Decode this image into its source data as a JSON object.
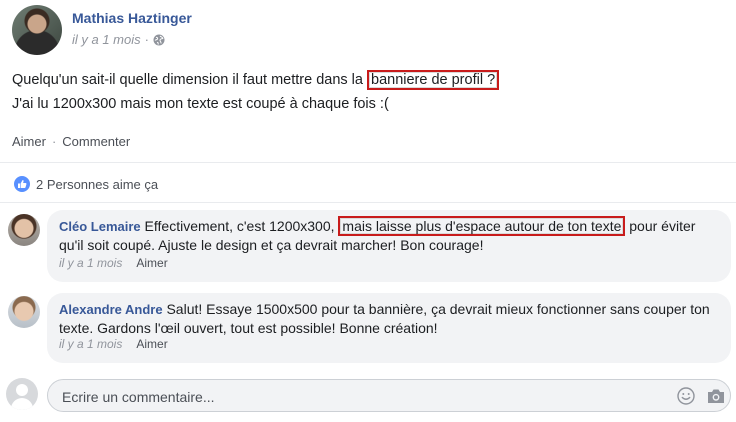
{
  "post": {
    "author": "Mathias Haztinger",
    "time": "il y a 1 mois",
    "meta_separator": "·",
    "text_line1_before": "Quelqu'un sait-il quelle dimension il faut mettre dans la ",
    "text_line1_highlight": "banniere de profil ?",
    "text_line2": "J'ai lu 1200x300 mais mon texte est coupé à chaque fois :("
  },
  "actions": {
    "like_label": "Aimer",
    "separator": "·",
    "comment_label": "Commenter"
  },
  "likes": {
    "text": "2 Personnes aime ça"
  },
  "comments": [
    {
      "author": "Cléo Lemaire",
      "text_before": "Effectivement, c'est 1200x300, ",
      "text_highlight": "mais laisse plus d'espace autour de ton texte",
      "text_after": " pour éviter qu'il soit coupé. Ajuste le design et ça devrait marcher! Bon courage!",
      "time": "il y a 1 mois",
      "like_label": "Aimer"
    },
    {
      "author": "Alexandre Andre",
      "text": "Salut! Essaye 1500x500 pour ta bannière, ça devrait mieux fonctionner sans couper ton texte. Gardons l'œil ouvert, tout est possible! Bonne création!",
      "time": "il y a 1 mois",
      "like_label": "Aimer"
    }
  ],
  "composer": {
    "placeholder": "Ecrire un commentaire..."
  },
  "colors": {
    "link": "#385898",
    "highlight_border": "#c81b1b",
    "like_badge": "#5890ff"
  }
}
